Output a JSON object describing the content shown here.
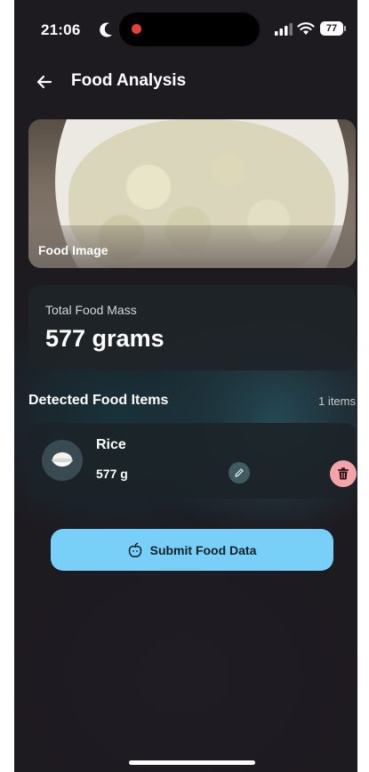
{
  "status_bar": {
    "time": "21:06",
    "battery": "77"
  },
  "header": {
    "title": "Food Analysis"
  },
  "image_card": {
    "label": "Food Image"
  },
  "mass_card": {
    "label": "Total Food Mass",
    "value": "577 grams"
  },
  "detected": {
    "title": "Detected Food Items",
    "count": "1 items",
    "items": [
      {
        "name": "Rice",
        "weight": "577 g"
      }
    ]
  },
  "submit": {
    "label": "Submit Food Data"
  },
  "colors": {
    "background": "#1d1a20",
    "accent": "#78cff8",
    "delete": "#f4a4a8",
    "edit": "#3f5b63"
  },
  "icons": {
    "moon": "moon-icon",
    "signal": "signal-icon",
    "wifi": "wifi-icon",
    "back": "arrow-left-icon",
    "food": "rice-bowl-icon",
    "edit": "pencil-icon",
    "delete": "trash-icon",
    "submit": "apple-icon"
  }
}
